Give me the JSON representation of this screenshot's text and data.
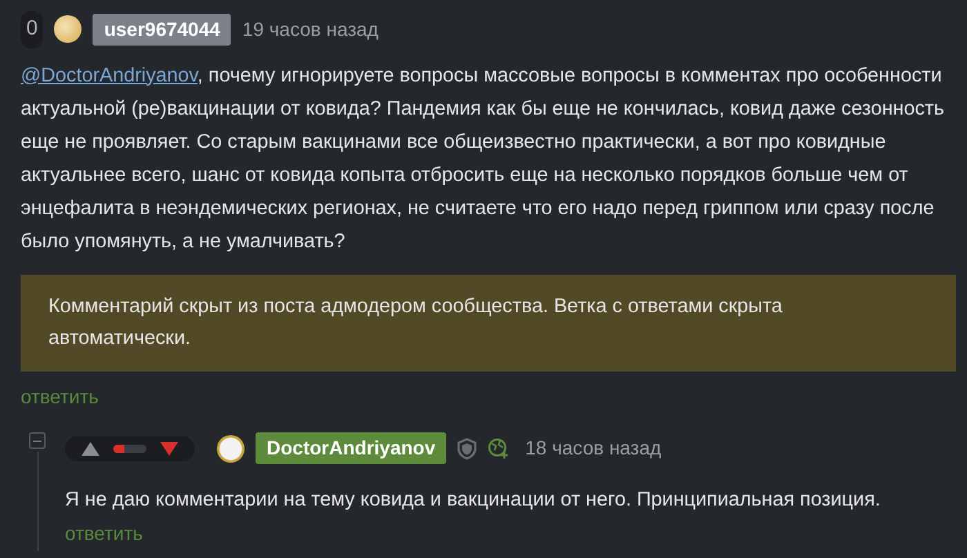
{
  "comment": {
    "rating": "0",
    "username": "user9674044",
    "time": "19 часов назад",
    "mention": "@DoctorAndriyanov",
    "text": ", почему игнорируете вопросы массовые вопросы в комментах про особенности актуальной (ре)вакцинации от ковида? Пандемия как бы еще не кончилась, ковид даже сезонность еще не проявляет. Со старым вакцинами все общеизвестно практически, а вот про ковидные актуальнее всего, шанс от ковида копыта отбросить еще на несколько порядков больше чем от энцефалита в неэндемических регионах, не считаете что его надо перед гриппом или сразу после было упомянуть, а не умалчивать?",
    "hidden_notice": "Комментарий скрыт из поста адмодером сообщества. Ветка с ответами скрыта автоматически.",
    "reply_link": "ответить"
  },
  "reply": {
    "collapsed": false,
    "vote": {
      "level": 0.35
    },
    "username": "DoctorAndriyanov",
    "time": "18 часов назад",
    "text": "Я не даю комментарии на тему ковида и вакцинации от него. Принципиальная позиция.",
    "reply_link": "ответить"
  }
}
